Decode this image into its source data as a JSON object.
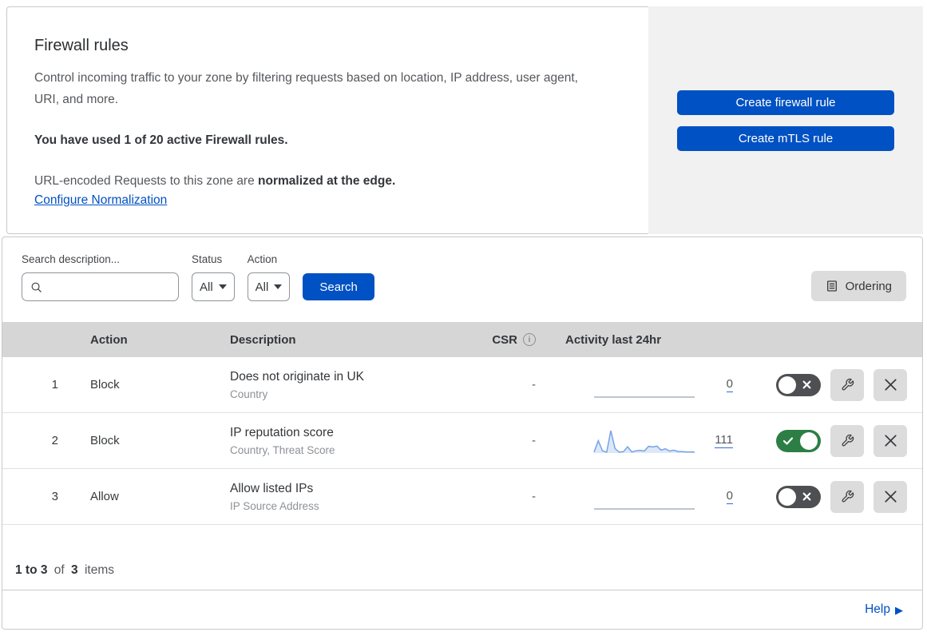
{
  "colors": {
    "accent_blue": "#0051c3",
    "toggle_on_green": "#2c7e45",
    "toggle_off_gray": "#4d4f52",
    "sparkline_blue": "#75a3e7",
    "sparkline_fill": "#dce8f8",
    "sparkline_flat": "#a9b2bc"
  },
  "icons": {
    "info": "i",
    "help_arrow": "▶"
  },
  "header": {
    "title": "Firewall rules",
    "description": "Control incoming traffic to your zone by filtering requests based on location, IP address, user agent, URI, and more.",
    "usage_bold": "You have used 1 of 20 active Firewall rules.",
    "norm_prefix": "URL-encoded Requests to this zone are ",
    "norm_bold": "normalized at the edge.",
    "norm_link": "Configure Normalization"
  },
  "actions_panel": {
    "create_firewall_rule": "Create firewall rule",
    "create_mtls_rule": "Create mTLS rule"
  },
  "filters": {
    "search_label": "Search description...",
    "status_label": "Status",
    "status_value": "All",
    "action_label": "Action",
    "action_value": "All",
    "search_button": "Search",
    "ordering_button": "Ordering"
  },
  "table": {
    "headers": {
      "action": "Action",
      "description": "Description",
      "csr": "CSR",
      "activity": "Activity last 24hr"
    },
    "rows": [
      {
        "priority": "1",
        "action": "Block",
        "description": "Does not originate in UK",
        "fields": "Country",
        "csr": "-",
        "activity_count": "0",
        "enabled": false,
        "sparkline": [
          0,
          0,
          0,
          0,
          0,
          0,
          0,
          0,
          0,
          0,
          0,
          0,
          0,
          0,
          0,
          0,
          0,
          0,
          0,
          0,
          0,
          0,
          0,
          0,
          0
        ]
      },
      {
        "priority": "2",
        "action": "Block",
        "description": "IP reputation score",
        "fields": "Country, Threat Score",
        "csr": "-",
        "activity_count": "111",
        "enabled": true,
        "sparkline": [
          4,
          55,
          10,
          4,
          100,
          20,
          4,
          6,
          28,
          5,
          10,
          12,
          9,
          30,
          27,
          31,
          13,
          19,
          9,
          13,
          7,
          6,
          5,
          5,
          4
        ]
      },
      {
        "priority": "3",
        "action": "Allow",
        "description": "Allow listed IPs",
        "fields": "IP Source Address",
        "csr": "-",
        "activity_count": "0",
        "enabled": false,
        "sparkline": [
          0,
          0,
          0,
          0,
          0,
          0,
          0,
          0,
          0,
          0,
          0,
          0,
          0,
          0,
          0,
          0,
          0,
          0,
          0,
          0,
          0,
          0,
          0,
          0,
          0
        ]
      }
    ]
  },
  "footer": {
    "range": "1 to 3",
    "of": "of",
    "total": "3",
    "items": "items"
  },
  "help": {
    "label": "Help"
  }
}
